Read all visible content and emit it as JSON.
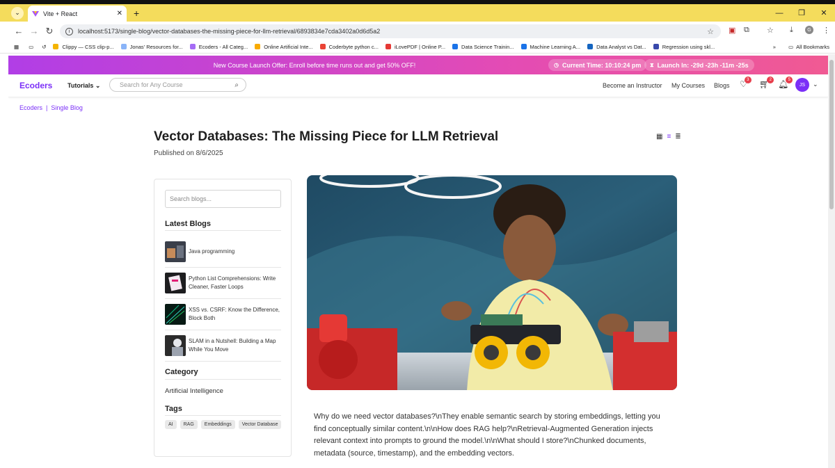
{
  "browser": {
    "tab_title": "Vite + React",
    "url": "localhost:5173/single-blog/vector-databases-the-missing-piece-for-llm-retrieval/6893834e7cda3402a0d6d5a2",
    "bookmarks": [
      {
        "label": "Clippy — CSS clip-p...",
        "color": "#f4b400"
      },
      {
        "label": "Jonas' Resources for...",
        "color": "#8ab4f8"
      },
      {
        "label": "Ecoders - All Categ...",
        "color": "#a56cf5"
      },
      {
        "label": "Online Artificial Inte...",
        "color": "#f9ab00"
      },
      {
        "label": "Coderbyte python c...",
        "color": "#ea4335"
      },
      {
        "label": "iLovePDF | Online P...",
        "color": "#e53935"
      },
      {
        "label": "Data Science Trainin...",
        "color": "#1a73e8"
      },
      {
        "label": "Machine Learning A...",
        "color": "#1a73e8"
      },
      {
        "label": "Data Analyst vs Dat...",
        "color": "#1565c0"
      },
      {
        "label": "Regression using skl...",
        "color": "#3949ab"
      }
    ],
    "all_bookmarks": "All Bookmarks"
  },
  "promo": {
    "message": "New Course Launch Offer: Enroll before time runs out and get 50% OFF!",
    "current_time": "Current Time: 10:10:24 pm",
    "launch": "Launch In: -29d -23h -11m -25s"
  },
  "header": {
    "brand": "Ecoders",
    "tutorials": "Tutorials",
    "search_placeholder": "Search for Any Course",
    "links": [
      "Become an Instructor",
      "My Courses",
      "Blogs"
    ],
    "wishlist_count": "3",
    "cart_count": "2",
    "notif_count": "5",
    "avatar": "JS"
  },
  "breadcrumb": [
    "Ecoders",
    "Single Blog"
  ],
  "post": {
    "title": "Vector Databases: The Missing Piece for LLM Retrieval",
    "published": "Published on 8/6/2025",
    "body": "Why do we need vector databases?\\nThey enable semantic search by storing embeddings, letting you find conceptually similar content.\\n\\nHow does RAG help?\\nRetrieval-Augmented Generation injects relevant context into prompts to ground the model.\\n\\nWhat should I store?\\nChunked documents, metadata (source, timestamp), and the embedding vectors."
  },
  "sidebar": {
    "search_placeholder": "Search blogs...",
    "latest_heading": "Latest Blogs",
    "latest": [
      "Java programming",
      "Python List Comprehensions: Write Cleaner, Faster Loops",
      "XSS vs. CSRF: Know the Difference, Block Both",
      "SLAM in a Nutshell: Building a Map While You Move"
    ],
    "category_heading": "Category",
    "category": "Artificial Intelligence",
    "tags_heading": "Tags",
    "tags": [
      "AI",
      "RAG",
      "Embeddings",
      "Vector Database"
    ]
  }
}
